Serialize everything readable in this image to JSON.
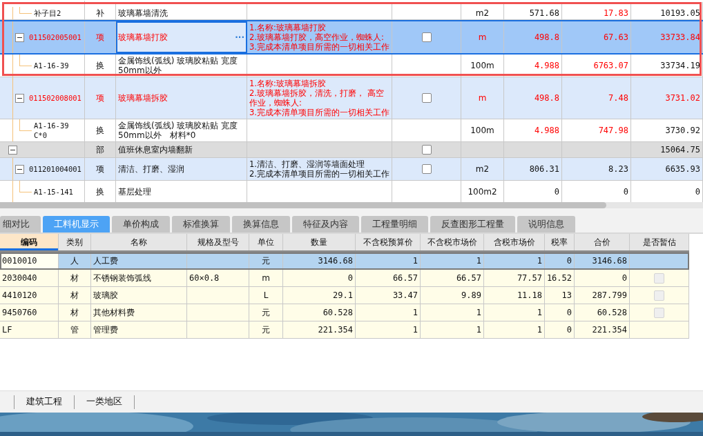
{
  "highlight_frame": true,
  "bill_grid": {
    "tree": [
      {
        "kind": "group",
        "children": [
          {
            "kind": "group",
            "children": [
              {
                "kind": "quota",
                "code": "补子目2",
                "type": "补",
                "name": "玻璃幕墙清洗",
                "unit": "m2",
                "qty": "571.68",
                "price": "17.83",
                "total": "10193.05",
                "selected": false,
                "text_red": false,
                "qty_red": false,
                "price_red": true
              }
            ]
          },
          {
            "kind": "bill",
            "code": "011502005001",
            "type": "项",
            "name": "玻璃幕墙打胶",
            "more_button": "···",
            "features": [
              "1.名称:玻璃幕墙打胶",
              "2.玻璃幕墙打胶，高空作业，蜘蛛人:",
              "3.完成本清单项目所需的一切相关工作"
            ],
            "checked": false,
            "unit": "m",
            "qty": "498.8",
            "price": "67.63",
            "total": "33733.84",
            "selected": true,
            "expanded": true,
            "text_red": true,
            "qty_red": true,
            "price_red": true,
            "children": [
              {
                "kind": "quota",
                "code": "A1-16-39",
                "type": "换",
                "name": "金属饰线(弧线) 玻璃胶粘贴 宽度50mm以外",
                "unit": "100m",
                "qty": "4.988",
                "price": "6763.07",
                "total": "33734.19",
                "selected": false,
                "text_red": false,
                "qty_red": true,
                "price_red": true
              }
            ]
          },
          {
            "kind": "bill",
            "code": "011502008001",
            "type": "项",
            "name": "玻璃幕墙拆胶",
            "features": [
              "1.名称:玻璃幕墙拆胶",
              "2.玻璃幕墙拆胶，清洗，打磨， 高空作业，蜘蛛人:",
              "3.完成本清单项目所需的一切相关工作"
            ],
            "checked": false,
            "unit": "m",
            "qty": "498.8",
            "price": "7.48",
            "total": "3731.02",
            "selected": false,
            "expanded": true,
            "text_red": true,
            "qty_red": true,
            "price_red": true,
            "children": [
              {
                "kind": "quota",
                "code": "A1-16-39 C*0",
                "type": "换",
                "name": "金属饰线(弧线) 玻璃胶粘贴 宽度50mm以外　材料*0",
                "unit": "100m",
                "qty": "4.988",
                "price": "747.98",
                "total": "3730.92",
                "selected": false,
                "text_red": false,
                "qty_red": true,
                "price_red": true
              }
            ]
          }
        ]
      },
      {
        "kind": "section",
        "type": "部",
        "name": "值班休息室内墙翻新",
        "checked": false,
        "total": "15064.75",
        "selected": false,
        "expanded": true,
        "text_red": false,
        "children": [
          {
            "kind": "bill",
            "code": "011201004001",
            "type": "项",
            "name": "清洁、打磨、湿润",
            "features": [
              "1.清洁、打磨、湿润等墙面处理",
              "2.完成本清单项目所需的一切相关工作"
            ],
            "checked": false,
            "unit": "m2",
            "qty": "806.31",
            "price": "8.23",
            "total": "6635.93",
            "selected": false,
            "expanded": true,
            "text_red": false,
            "qty_red": false,
            "price_red": false,
            "children": [
              {
                "kind": "quota",
                "code": "A1-15-141",
                "type": "换",
                "name": "基层处理",
                "unit": "100m2",
                "qty": "0",
                "price": "0",
                "total": "0",
                "selected": false,
                "text_red": false,
                "qty_red": false,
                "price_red": false
              }
            ]
          }
        ]
      }
    ]
  },
  "detail_tabs": [
    {
      "label": "细对比",
      "selected": false
    },
    {
      "label": "工料机显示",
      "selected": true
    },
    {
      "label": "单价构成",
      "selected": false
    },
    {
      "label": "标准换算",
      "selected": false
    },
    {
      "label": "换算信息",
      "selected": false
    },
    {
      "label": "特征及内容",
      "selected": false
    },
    {
      "label": "工程量明细",
      "selected": false
    },
    {
      "label": "反查图形工程量",
      "selected": false
    },
    {
      "label": "说明信息",
      "selected": false
    }
  ],
  "resource_table": {
    "columns": [
      {
        "label": "编码",
        "active": true
      },
      {
        "label": "类别",
        "active": false
      },
      {
        "label": "名称",
        "active": false
      },
      {
        "label": "规格及型号",
        "active": false
      },
      {
        "label": "单位",
        "active": false
      },
      {
        "label": "数量",
        "active": false
      },
      {
        "label": "不含税预算价",
        "active": false
      },
      {
        "label": "不含税市场价",
        "active": false
      },
      {
        "label": "含税市场价",
        "active": false
      },
      {
        "label": "税率",
        "active": false
      },
      {
        "label": "合价",
        "active": false
      },
      {
        "label": "是否暂估",
        "active": false
      }
    ],
    "rows": [
      {
        "code": "0010010",
        "type": "人",
        "name": "人工费",
        "spec": "",
        "unit": "元",
        "qty": "3146.68",
        "budget_price": "1",
        "market_price": "1",
        "tax_price": "1",
        "tax_rate": "0",
        "amount": "3146.68",
        "selected": true
      },
      {
        "code": "2030040",
        "type": "材",
        "name": "不锈钢装饰弧线",
        "spec": "60×0.8",
        "unit": "m",
        "qty": "0",
        "budget_price": "66.57",
        "market_price": "66.57",
        "tax_price": "77.57",
        "tax_rate": "16.52",
        "amount": "0",
        "estimate": false,
        "selected": false
      },
      {
        "code": "4410120",
        "type": "材",
        "name": "玻璃胶",
        "spec": "",
        "unit": "L",
        "qty": "29.1",
        "budget_price": "33.47",
        "market_price": "9.89",
        "tax_price": "11.18",
        "tax_rate": "13",
        "amount": "287.799",
        "estimate": false,
        "selected": false
      },
      {
        "code": "9450760",
        "type": "材",
        "name": "其他材料费",
        "spec": "",
        "unit": "元",
        "qty": "60.528",
        "budget_price": "1",
        "market_price": "1",
        "tax_price": "1",
        "tax_rate": "0",
        "amount": "60.528",
        "estimate": false,
        "selected": false
      },
      {
        "code": "LF",
        "type": "管",
        "name": "管理费",
        "spec": "",
        "unit": "元",
        "qty": "221.354",
        "budget_price": "1",
        "market_price": "1",
        "tax_price": "1",
        "tax_rate": "0",
        "amount": "221.354",
        "selected": false
      }
    ]
  },
  "status_bar": [
    "建筑工程",
    "一类地区"
  ]
}
